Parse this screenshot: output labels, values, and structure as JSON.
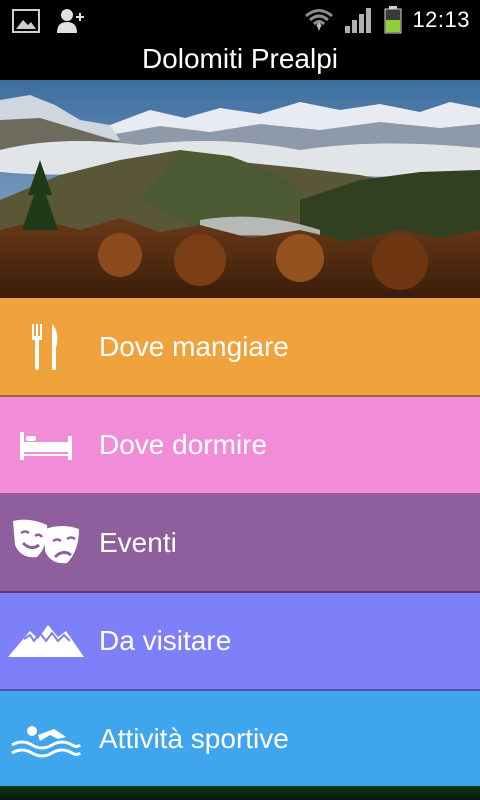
{
  "status_bar": {
    "time": "12:13",
    "icons": [
      "image-icon",
      "add-contact-icon",
      "wifi-icon",
      "signal-icon",
      "battery-icon"
    ]
  },
  "header": {
    "title": "Dolomiti Prealpi"
  },
  "menu": {
    "items": [
      {
        "label": "Dove mangiare",
        "icon": "cutlery-icon",
        "color": "#F0A23C"
      },
      {
        "label": "Dove dormire",
        "icon": "bed-icon",
        "color": "#F08CD8"
      },
      {
        "label": "Eventi",
        "icon": "theater-masks-icon",
        "color": "#8E5F9C"
      },
      {
        "label": "Da visitare",
        "icon": "mountains-icon",
        "color": "#7E80FA"
      },
      {
        "label": "Attività sportive",
        "icon": "swimmer-icon",
        "color": "#3FA6EE"
      }
    ]
  }
}
